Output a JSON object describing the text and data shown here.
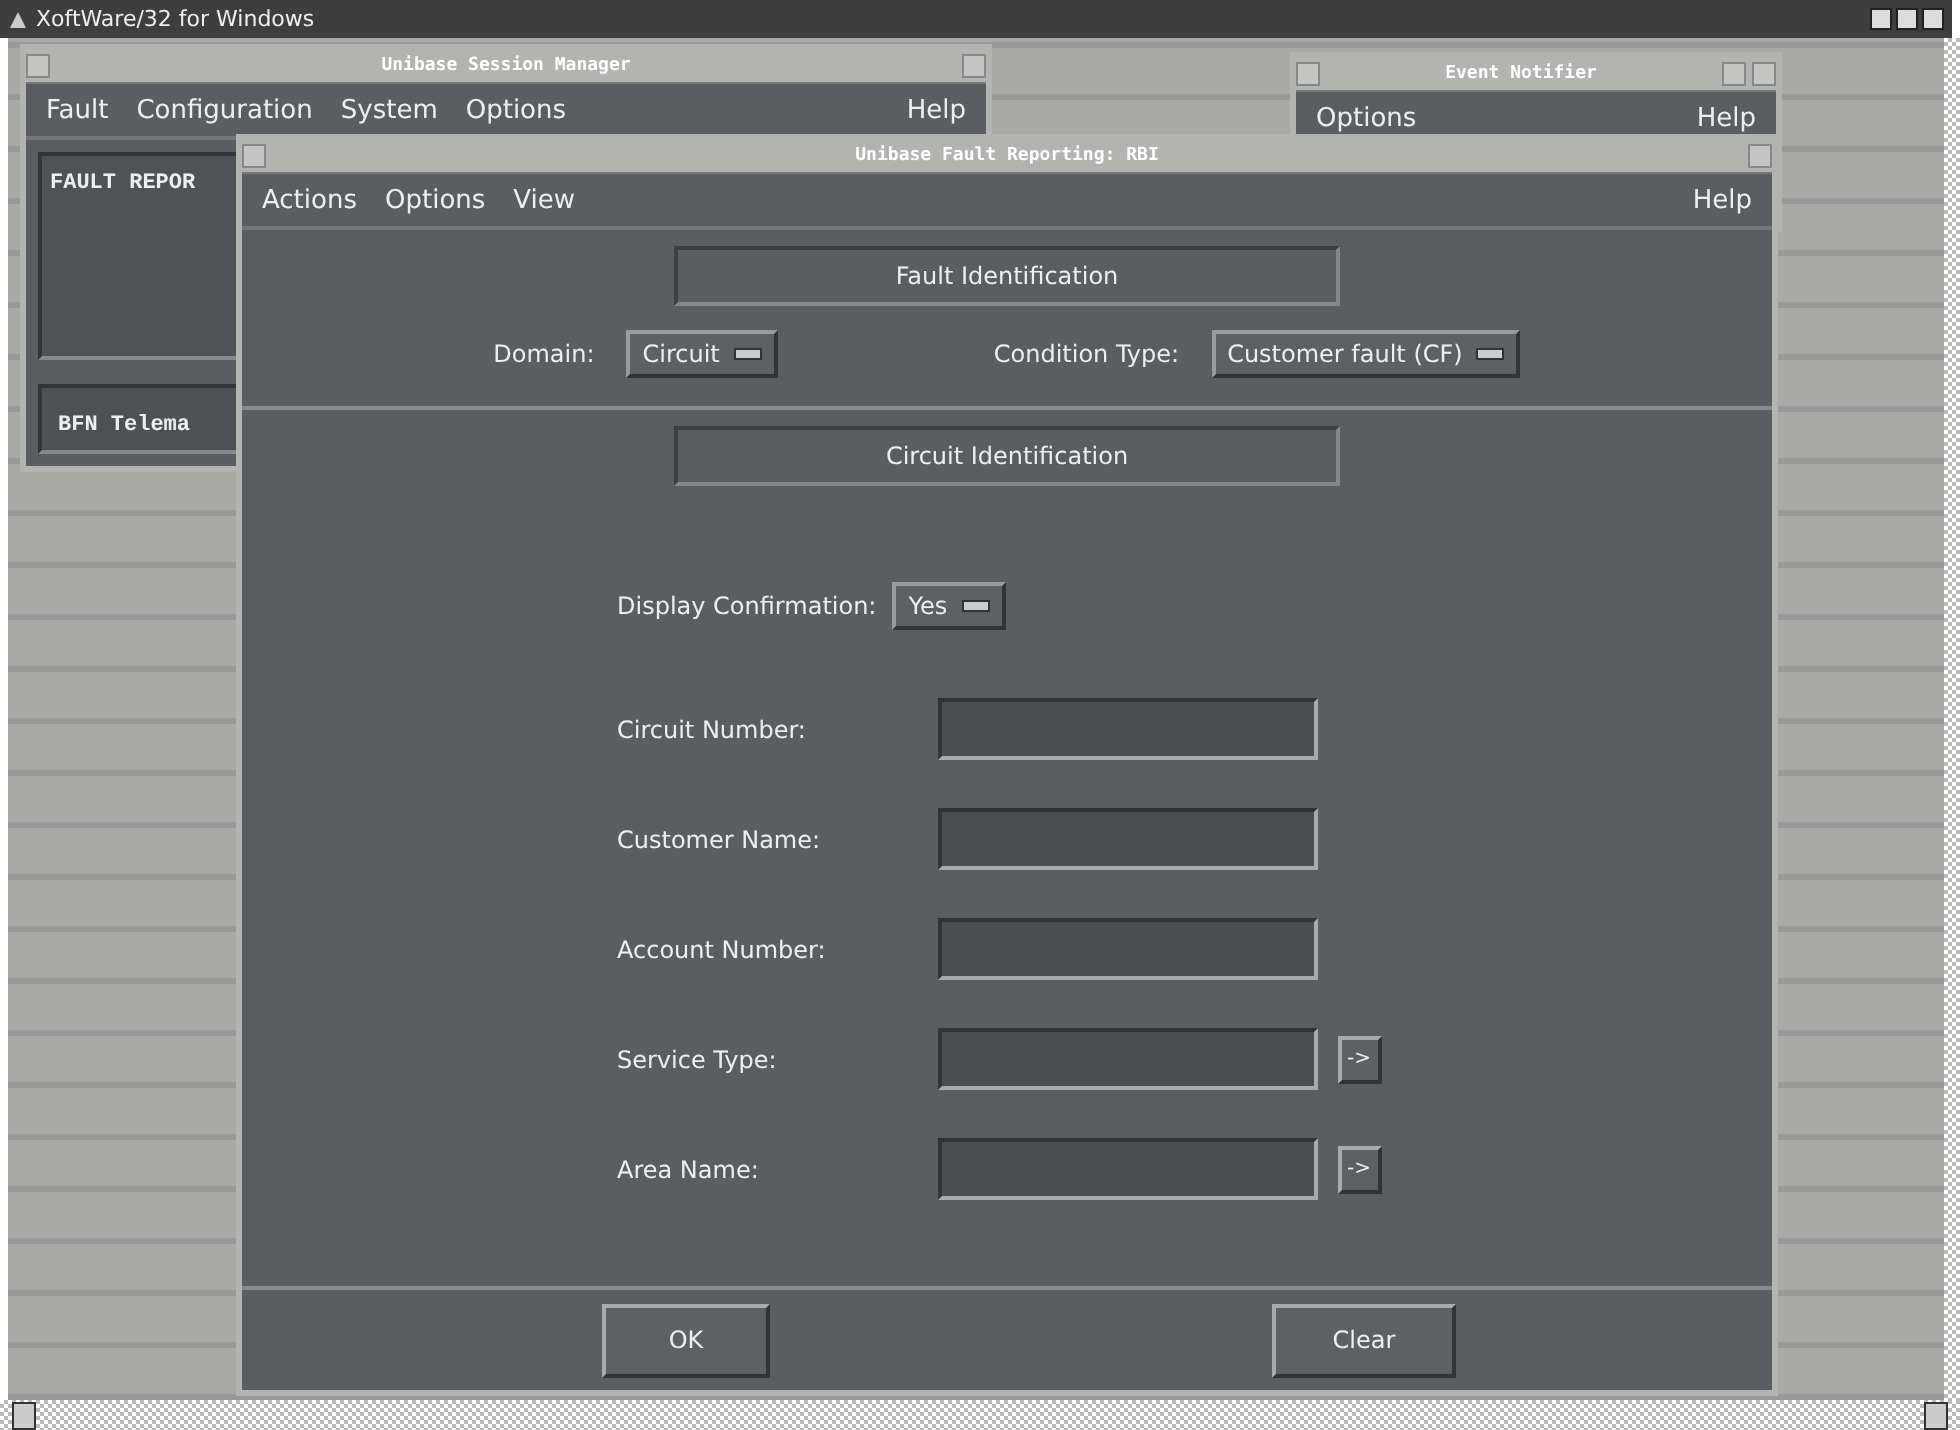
{
  "desktop": {
    "title": "XoftWare/32 for Windows"
  },
  "session_manager": {
    "title": "Unibase Session Manager",
    "menu": [
      "Fault",
      "Configuration",
      "System",
      "Options"
    ],
    "help_menu": "Help",
    "content": "FAULT REPOR",
    "footer": "BFN Telema"
  },
  "event_notifier": {
    "title": "Event Notifier",
    "menu": [
      "Options"
    ],
    "help_menu": "Help"
  },
  "fault_window": {
    "title": "Unibase Fault Reporting: RBI",
    "menu": [
      "Actions",
      "Options",
      "View"
    ],
    "help_menu": "Help",
    "fault_identification": {
      "heading": "Fault Identification",
      "domain": {
        "label": "Domain:",
        "value": "Circuit"
      },
      "condition_type": {
        "label": "Condition Type:",
        "value": "Customer fault (CF)"
      }
    },
    "circuit_identification": {
      "heading": "Circuit Identification",
      "display_confirmation": {
        "label": "Display Confirmation:",
        "value": "Yes"
      },
      "fields": [
        {
          "label": "Circuit Number:"
        },
        {
          "label": "Customer Name:"
        },
        {
          "label": "Account Number:"
        },
        {
          "label": "Service Type:",
          "button": "->"
        },
        {
          "label": "Area Name:",
          "button": "->"
        }
      ]
    },
    "buttons": [
      "OK",
      "Clear"
    ]
  }
}
